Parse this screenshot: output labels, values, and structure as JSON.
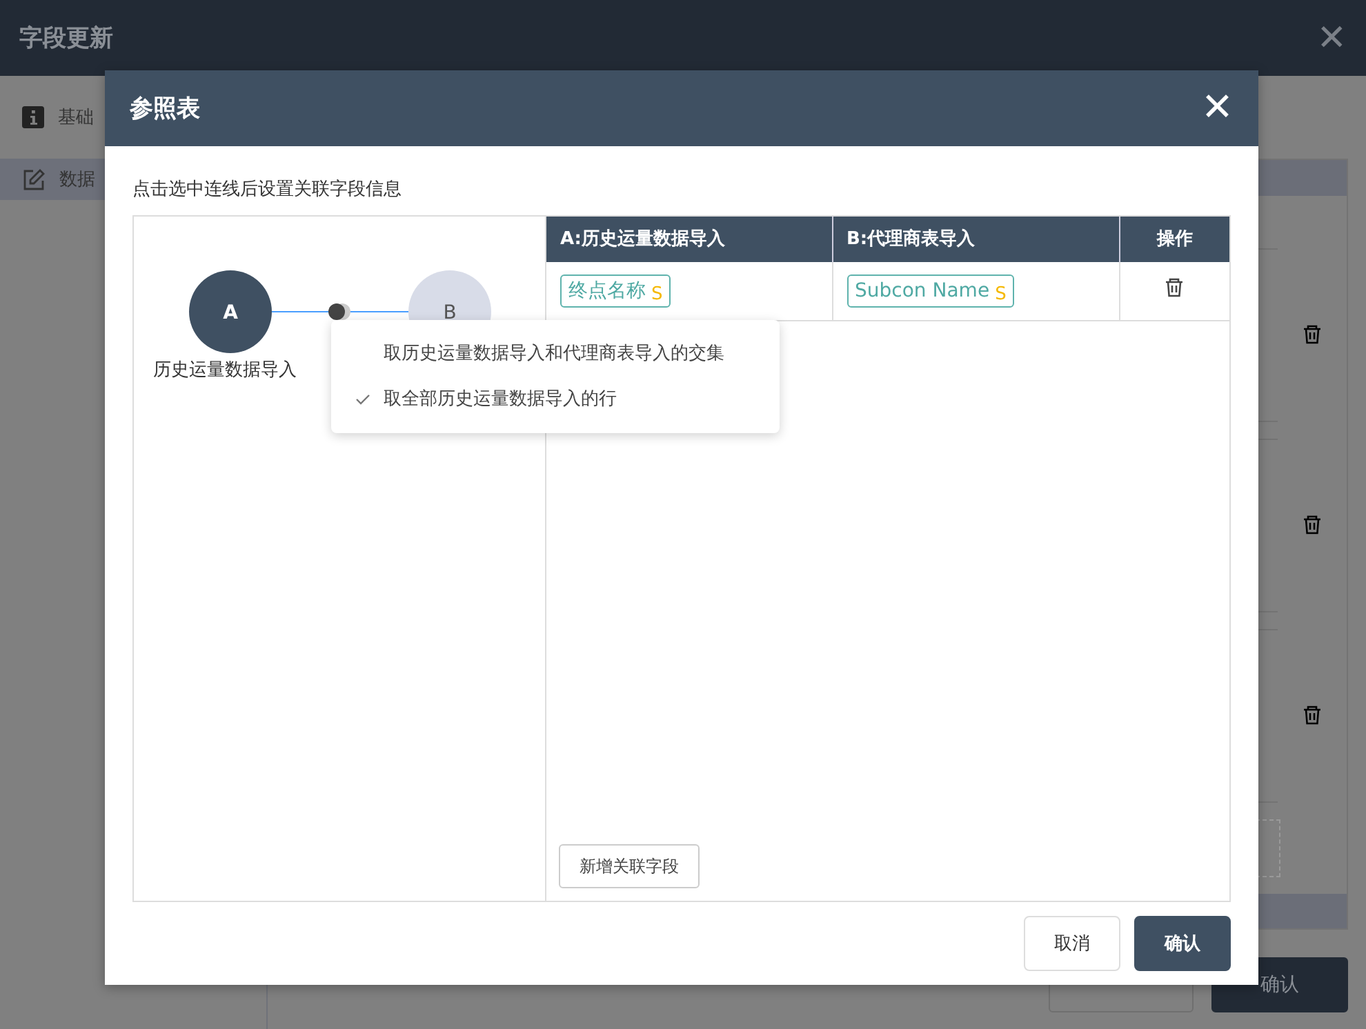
{
  "background": {
    "title": "字段更新",
    "close": "✕",
    "sidebar": [
      {
        "label": "基础",
        "selected": false
      },
      {
        "label": "数据",
        "selected": true
      }
    ],
    "confirm_button": "确认"
  },
  "dialog": {
    "title": "参照表",
    "close": "✕",
    "hint": "点击选中连线后设置关联字段信息",
    "diagram": {
      "nodes": [
        {
          "letter": "A",
          "label": "历史运量数据导入",
          "selected": true
        },
        {
          "letter": "B",
          "selected": false
        }
      ],
      "join_menu": [
        {
          "label": "取历史运量数据导入和代理商表导入的交集",
          "checked": false
        },
        {
          "label": "取全部历史运量数据导入的行",
          "checked": true
        }
      ]
    },
    "table": {
      "columns": [
        "A:历史运量数据导入",
        "B:代理商表导入",
        "操作"
      ],
      "rows": [
        {
          "a": "终点名称",
          "a_type": "S",
          "b": "Subcon Name",
          "b_type": "S"
        }
      ]
    },
    "add_button": "新增关联字段",
    "buttons": [
      "取消",
      "确认"
    ]
  }
}
